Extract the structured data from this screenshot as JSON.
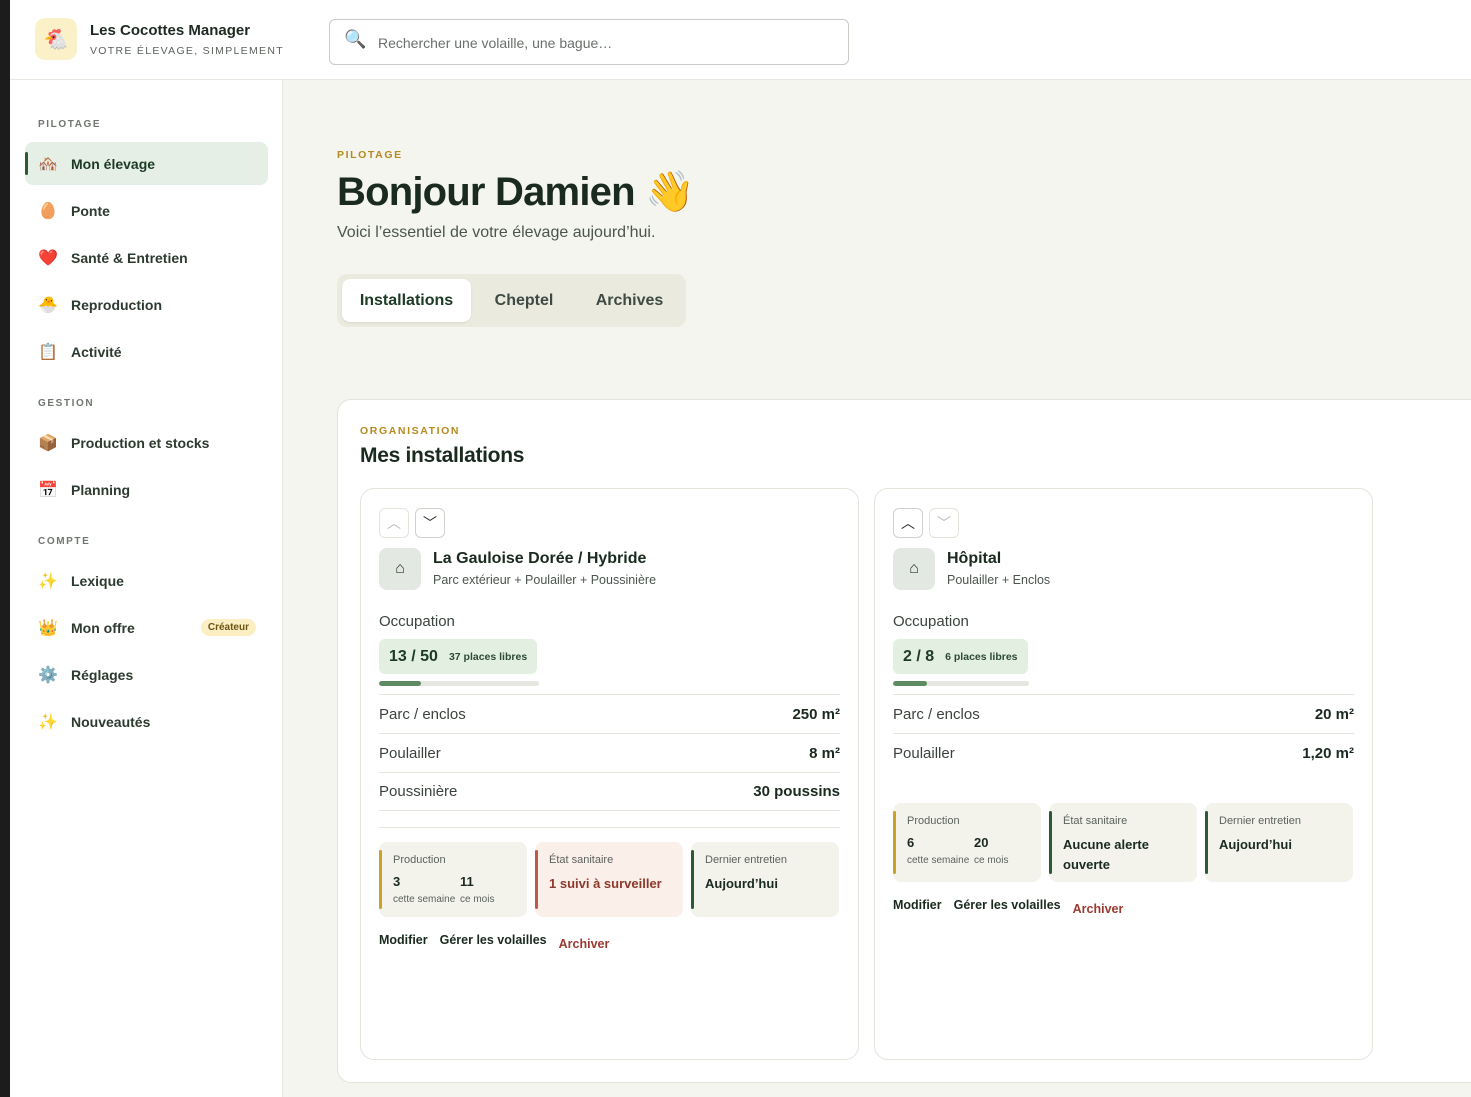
{
  "brand": {
    "name": "Les Cocottes Manager",
    "tagline": "VOTRE ÉLEVAGE, SIMPLEMENT",
    "logo_icon": "chicken-icon"
  },
  "search": {
    "placeholder": "Rechercher une volaille, une bague…"
  },
  "sidebar": {
    "sections": [
      {
        "title": "PILOTAGE",
        "items": [
          {
            "label": "Mon élevage",
            "icon": "🏘️",
            "active": true
          },
          {
            "label": "Ponte",
            "icon": "🥚"
          },
          {
            "label": "Santé & Entretien",
            "icon": "❤️"
          },
          {
            "label": "Reproduction",
            "icon": "🐣"
          },
          {
            "label": "Activité",
            "icon": "📋"
          }
        ]
      },
      {
        "title": "GESTION",
        "items": [
          {
            "label": "Production et stocks",
            "icon": "📦"
          },
          {
            "label": "Planning",
            "icon": "📅"
          }
        ]
      },
      {
        "title": "COMPTE",
        "items": [
          {
            "label": "Lexique",
            "icon": "✨"
          },
          {
            "label": "Mon offre",
            "icon": "👑",
            "badge": "Créateur"
          },
          {
            "label": "Réglages",
            "icon": "⚙️"
          },
          {
            "label": "Nouveautés",
            "icon": "✨"
          }
        ]
      }
    ]
  },
  "main": {
    "eyebrow": "PILOTAGE",
    "title": "Bonjour Damien 👋",
    "subtitle": "Voici l’essentiel de votre élevage aujourd’hui.",
    "tabs": [
      {
        "label": "Installations",
        "active": true
      },
      {
        "label": "Cheptel"
      },
      {
        "label": "Archives"
      }
    ]
  },
  "panel": {
    "eyebrow": "ORGANISATION",
    "title": "Mes installations",
    "cards": [
      {
        "name": "La Gauloise Dorée / Hybride",
        "description": "Parc extérieur + Poulailler + Poussinière",
        "occupation_label": "Occupation",
        "occupation": "13 / 50",
        "occupation_fraction": 0.26,
        "free_places": "37 places libres",
        "specs": [
          {
            "label": "Parc / enclos",
            "value": "250 m²"
          },
          {
            "label": "Poulailler",
            "value": "8 m²"
          },
          {
            "label": "Poussinière",
            "value": "30 poussins"
          }
        ],
        "production": {
          "label": "Production",
          "week": "3",
          "week_unit": "cette semaine",
          "month": "11",
          "month_unit": "ce mois"
        },
        "health": {
          "label": "État sanitaire",
          "value": "1 suivi à surveiller",
          "alert": true
        },
        "maintenance": {
          "label": "Dernier entretien",
          "value": "Aujourd’hui"
        },
        "actions": {
          "edit": "Modifier",
          "manage": "Gérer les volailles",
          "archive": "Archiver"
        }
      },
      {
        "name": "Hôpital",
        "description": "Poulailler + Enclos",
        "occupation_label": "Occupation",
        "occupation": "2 / 8",
        "occupation_fraction": 0.25,
        "free_places": "6 places libres",
        "specs": [
          {
            "label": "Parc / enclos",
            "value": "20 m²"
          },
          {
            "label": "Poulailler",
            "value": "1,20 m²"
          }
        ],
        "production": {
          "label": "Production",
          "week": "6",
          "week_unit": "cette semaine",
          "month": "20",
          "month_unit": "ce mois"
        },
        "health": {
          "label": "État sanitaire",
          "value": "Aucune alerte ouverte",
          "alert": false
        },
        "maintenance": {
          "label": "Dernier entretien",
          "value": "Aujourd’hui"
        },
        "actions": {
          "edit": "Modifier",
          "manage": "Gérer les volailles",
          "archive": "Archiver"
        }
      }
    ]
  },
  "colors": {
    "accent": "#2c5a35",
    "eyebrow": "#b58a1e",
    "production": "#c9a227",
    "alert": "#c0584a",
    "ok": "#2c5a35"
  }
}
